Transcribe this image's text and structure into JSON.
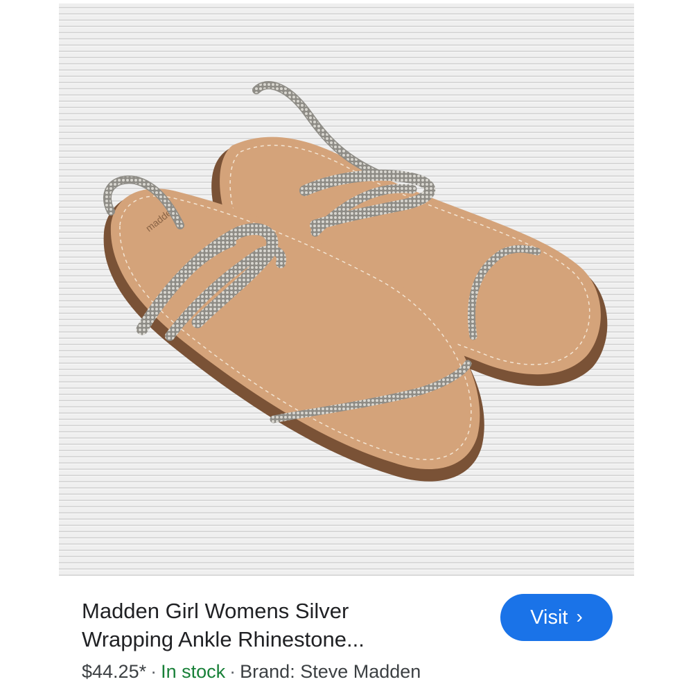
{
  "result": {
    "title_line1": "Madden Girl Womens Silver",
    "title_line2": "Wrapping Ankle Rhinestone...",
    "price": "$44.25*",
    "separator": "·",
    "stock": "In stock",
    "brand": "Brand: Steve Madden",
    "visit_label": "Visit",
    "visit_icon": "chevron-right-icon",
    "sole_text": "madden"
  },
  "colors": {
    "button": "#1a73e8",
    "stock": "#188038",
    "text": "#202124"
  }
}
